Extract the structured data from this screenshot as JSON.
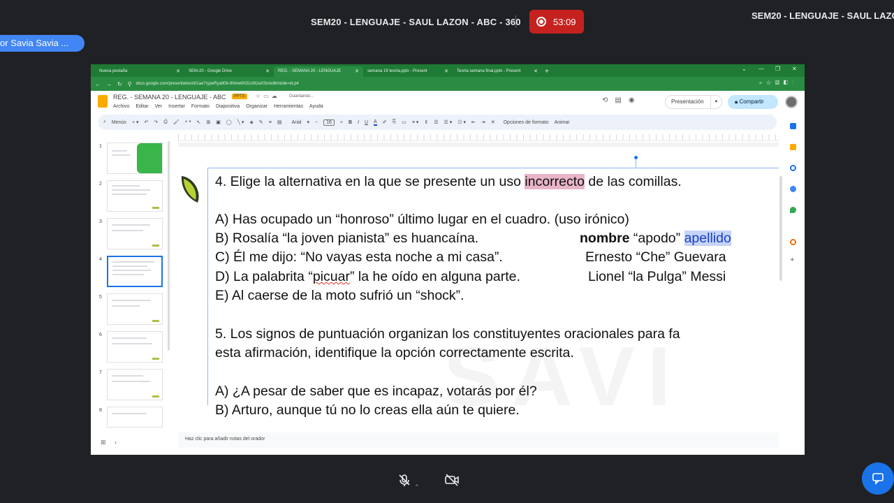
{
  "meeting": {
    "title": "SEM20 - LENGUAJE - SAUL LAZON - ABC - 360",
    "title_right": "SEM20 - LENGUAJE - SAUL LAZON",
    "timer": "53:09",
    "presenter": "or Savia Savia ..."
  },
  "browser": {
    "tabs": [
      {
        "label": "Nueva pestaña"
      },
      {
        "label": "SEM-20 - Google Drive"
      },
      {
        "label": "REG. - SEMANA 20 - LENGUAJE"
      },
      {
        "label": "semana 19 teoría.pptx - Present"
      },
      {
        "label": "Teoría semana final.pptx - Present"
      }
    ],
    "url": "docs.google.com/presentation/d/1ae7rypeRyatt0b-8hIow0h31o0tzaXSn/edit#slide=id.p4"
  },
  "docs": {
    "title": "REG. - SEMANA 20 - LENGUAJE - ABC",
    "badge": "PPTX",
    "status": "Guardando...",
    "menus": [
      "Archivo",
      "Editar",
      "Ver",
      "Insertar",
      "Formato",
      "Diapositiva",
      "Organizar",
      "Herramientas",
      "Ayuda"
    ],
    "present_label": "Presentación",
    "share_label": "Compartir",
    "toolbar": {
      "menu_label": "Menús",
      "font": "Arial",
      "font_size": "16",
      "format_options": "Opciones de formato",
      "animate": "Animar"
    },
    "slide_numbers": [
      "1",
      "2",
      "3",
      "4",
      "5",
      "6",
      "7",
      "8"
    ],
    "notes_placeholder": "Haz clic para añadir notas del orador"
  },
  "slide": {
    "q4_prefix": "4. Elige la alternativa en la que se presente un uso ",
    "q4_highlight": "incorrecto",
    "q4_suffix": " de las comillas.",
    "opt_a": "A) Has ocupado un “honroso” último lugar en el cuadro. (uso irónico)",
    "opt_b": "B) Rosalía “la joven pianista” es huancaína.",
    "opt_c": "C) Él me dijo: “No vayas esta noche a mi casa”.",
    "opt_d_pre": "D) La palabrita “",
    "opt_d_word": "picuar",
    "opt_d_post": "” la he oído en alguna parte.",
    "opt_e": "E) Al caerse de la moto sufrió un “shock”.",
    "note_nombre": "nombre",
    "note_apodo": " “apodo” ",
    "note_apellido": "apellido",
    "example_1": "Ernesto  “Che”  Guevara",
    "example_2": "Lionel “la Pulga” Messi",
    "q5_line1": "5. Los signos de puntuación organizan los constituyentes oracionales para fa",
    "q5_line2": "esta afirmación, identifique la opción correctamente escrita.",
    "q5_a": "A) ¿A pesar de saber que es incapaz, votarás por él?",
    "q5_b": "B) Arturo, aunque tú no lo creas ella aún te quiere.",
    "watermark": "SAVI"
  }
}
